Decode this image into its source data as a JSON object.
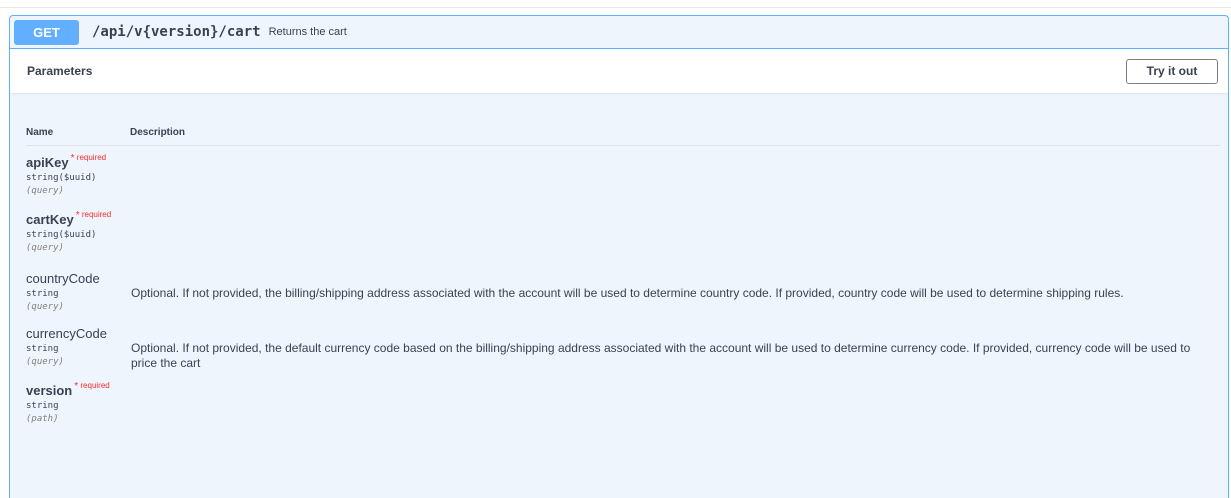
{
  "operation": {
    "method": "GET",
    "path": "/api/v{version}/cart",
    "summary": "Returns the cart"
  },
  "parameters_section": {
    "title": "Parameters",
    "try_button": "Try it out",
    "col_name": "Name",
    "col_description": "Description"
  },
  "params": [
    {
      "name": "apiKey",
      "required": true,
      "required_label": "required",
      "type": "string($uuid)",
      "in": "(query)",
      "description": ""
    },
    {
      "name": "cartKey",
      "required": true,
      "required_label": "required",
      "type": "string($uuid)",
      "in": "(query)",
      "description": ""
    },
    {
      "name": "countryCode",
      "required": false,
      "type": "string",
      "in": "(query)",
      "description": "Optional. If not provided, the billing/shipping address associated with the account will be used to determine country code. If provided, country code will be used to determine shipping rules."
    },
    {
      "name": "currencyCode",
      "required": false,
      "type": "string",
      "in": "(query)",
      "description": "Optional. If not provided, the default currency code based on the billing/shipping address associated with the account will be used to determine currency code. If provided, currency code will be used to price the cart"
    },
    {
      "name": "version",
      "required": true,
      "required_label": "required",
      "type": "string",
      "in": "(path)",
      "description": ""
    }
  ],
  "colors": {
    "get_accent": "#61affe",
    "block_bg": "#eef5fd",
    "required": "#ff2d2d",
    "text": "#3b4151"
  }
}
